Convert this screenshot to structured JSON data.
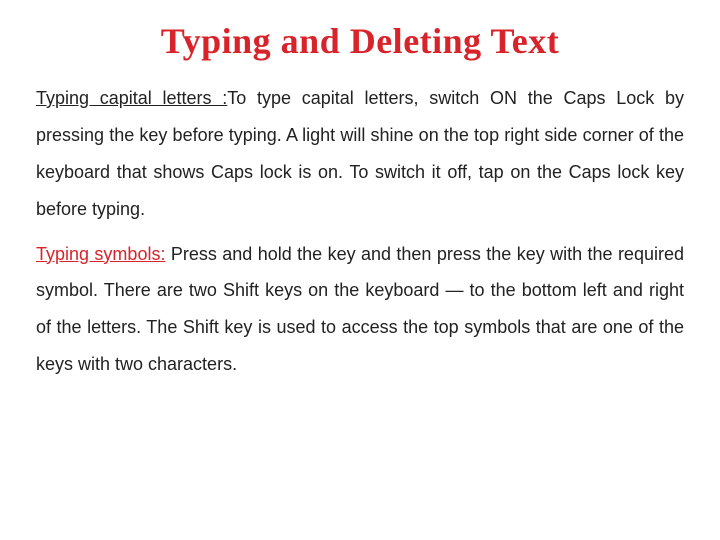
{
  "title": "Typing and Deleting Text",
  "para1_lead": "Typing capital letters :",
  "para1_body": "To type capital letters, switch ON the Caps Lock by pressing the key before typing. A light will shine on the top right side corner of the keyboard that shows Caps lock is on. To switch it off, tap on the Caps lock key before typing.",
  "para2_lead": "Typing symbols:",
  "para2_body": " Press and hold the key and then press the key with the required symbol. There are two Shift keys on the keyboard — to the bottom left and right of the letters. The Shift key is used to access the top symbols that are one of the keys with two characters."
}
